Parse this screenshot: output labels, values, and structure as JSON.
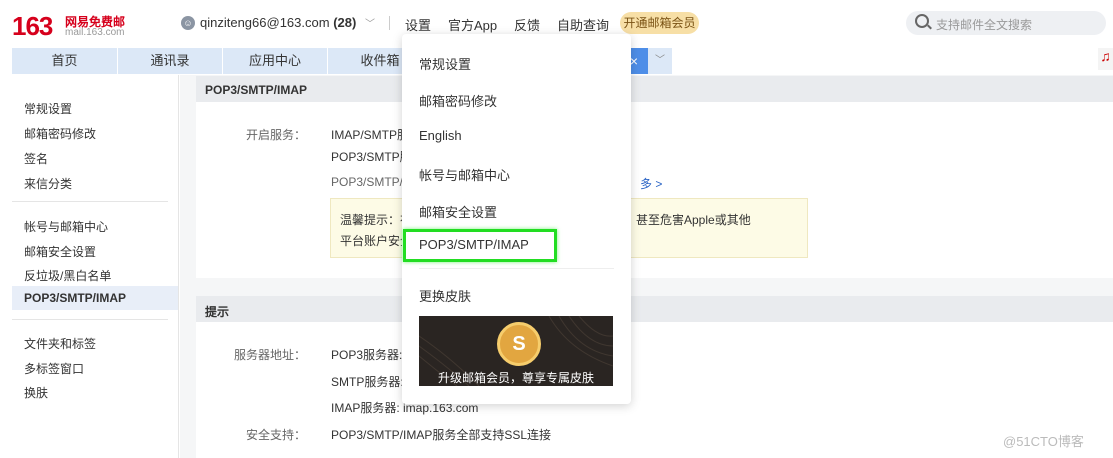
{
  "header": {
    "logo_number": "163",
    "logo_name": "网易免费邮",
    "logo_domain": "mail.163.com",
    "account_email": "qinziteng66@163.com",
    "account_count": "(28)",
    "nav": [
      "设置",
      "官方App",
      "反馈",
      "自助查询"
    ],
    "vip_button": "开通邮箱会员",
    "search_placeholder": "支持邮件全文搜索"
  },
  "tabs": [
    {
      "label": "首页"
    },
    {
      "label": "通讯录"
    },
    {
      "label": "应用中心"
    },
    {
      "label": "收件箱"
    }
  ],
  "tab_close": "×",
  "sidebar": {
    "group1": [
      "常规设置",
      "邮箱密码修改",
      "签名",
      "来信分类"
    ],
    "group2": [
      "帐号与邮箱中心",
      "邮箱安全设置",
      "反垃圾/黑白名单",
      "POP3/SMTP/IMAP"
    ],
    "group3": [
      "文件夹和标签",
      "多标签窗口",
      "换肤"
    ],
    "active": "POP3/SMTP/IMAP"
  },
  "section1": {
    "title": "POP3/SMTP/IMAP",
    "label": "开启服务：",
    "lines": [
      "IMAP/SMTP服",
      "POP3/SMTP服",
      "POP3/SMTP/I"
    ],
    "more_link": "多 >",
    "tip_line1": "温馨提示：在",
    "tip_line1_end": "甚至危害Apple或其他",
    "tip_line2": "平台账户安全"
  },
  "section2": {
    "title": "提示",
    "server_label": "服务器地址：",
    "pop3": "POP3服务器: p",
    "smtp": "SMTP服务器: s",
    "imap": "IMAP服务器: imap.163.com",
    "ssl_label": "安全支持：",
    "ssl_value": "POP3/SMTP/IMAP服务全部支持SSL连接"
  },
  "dropdown": {
    "items": [
      "常规设置",
      "邮箱密码修改",
      "English",
      "帐号与邮箱中心",
      "邮箱安全设置",
      "POP3/SMTP/IMAP",
      "更换皮肤"
    ],
    "highlighted": "POP3/SMTP/IMAP",
    "banner_text": "升级邮箱会员，尊享专属皮肤",
    "coin_symbol": "S"
  },
  "icons": {
    "account": "user-icon",
    "search": "search-icon",
    "music": "music-icon"
  },
  "watermark": "@51CTO博客",
  "colors": {
    "brand": "#d6001c",
    "highlight_box": "#22dd22",
    "tab_active": "#4e8ee8"
  }
}
